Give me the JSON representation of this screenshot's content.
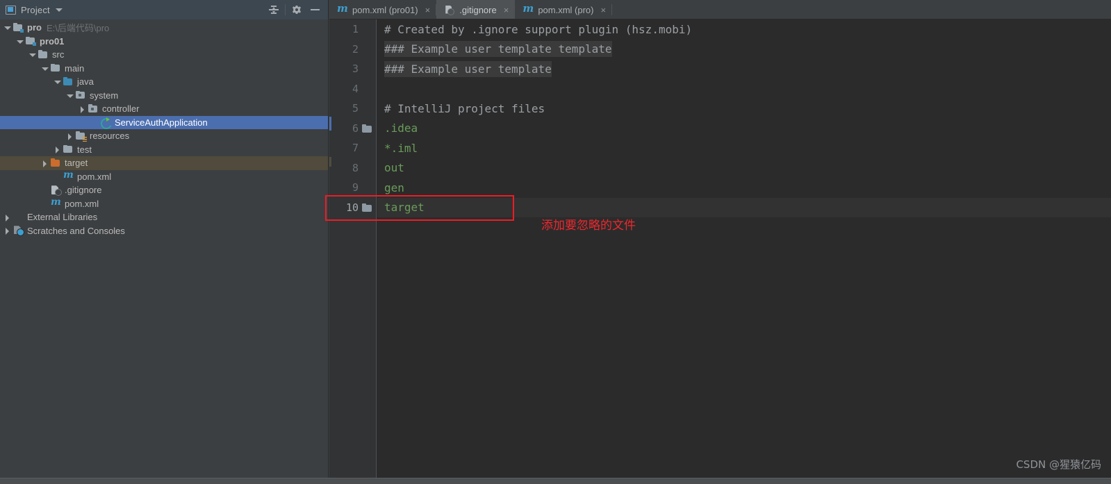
{
  "panel": {
    "title": "Project",
    "icons": {
      "panel_icon": "project-window-icon",
      "dropdown": "chevron-down-icon",
      "collapse_all": "collapse-all-icon",
      "settings": "gear-icon",
      "hide": "minimize-icon"
    }
  },
  "tree": {
    "items": [
      {
        "label": "pro",
        "path": "E:\\后端代码\\pro",
        "indent": 0,
        "arrow": "down",
        "icon": "module-folder-icon",
        "bold": true,
        "state": "normal"
      },
      {
        "label": "pro01",
        "path": "",
        "indent": 1,
        "arrow": "down",
        "icon": "module-folder-icon",
        "bold": true,
        "state": "normal"
      },
      {
        "label": "src",
        "path": "",
        "indent": 2,
        "arrow": "down",
        "icon": "folder-icon",
        "bold": false,
        "state": "normal"
      },
      {
        "label": "main",
        "path": "",
        "indent": 3,
        "arrow": "down",
        "icon": "folder-icon",
        "bold": false,
        "state": "normal"
      },
      {
        "label": "java",
        "path": "",
        "indent": 4,
        "arrow": "down",
        "icon": "source-folder-icon",
        "bold": false,
        "state": "normal"
      },
      {
        "label": "system",
        "path": "",
        "indent": 5,
        "arrow": "down",
        "icon": "package-icon",
        "bold": false,
        "state": "normal"
      },
      {
        "label": "controller",
        "path": "",
        "indent": 6,
        "arrow": "right",
        "icon": "package-icon",
        "bold": false,
        "state": "normal"
      },
      {
        "label": "ServiceAuthApplication",
        "path": "",
        "indent": 7,
        "arrow": "none",
        "icon": "spring-boot-class-icon",
        "bold": false,
        "state": "selected"
      },
      {
        "label": "resources",
        "path": "",
        "indent": 5,
        "arrow": "right",
        "icon": "resources-folder-icon",
        "bold": false,
        "state": "normal"
      },
      {
        "label": "test",
        "path": "",
        "indent": 4,
        "arrow": "right",
        "icon": "folder-icon",
        "bold": false,
        "state": "normal"
      },
      {
        "label": "target",
        "path": "",
        "indent": 3,
        "arrow": "right",
        "icon": "excluded-folder-icon",
        "bold": false,
        "state": "marked"
      },
      {
        "label": "pom.xml",
        "path": "",
        "indent": 4,
        "arrow": "none",
        "icon": "maven-file-icon",
        "bold": false,
        "state": "normal"
      },
      {
        "label": ".gitignore",
        "path": "",
        "indent": 3,
        "arrow": "none",
        "icon": "gitignore-file-icon",
        "bold": false,
        "state": "normal"
      },
      {
        "label": "pom.xml",
        "path": "",
        "indent": 3,
        "arrow": "none",
        "icon": "maven-file-icon",
        "bold": false,
        "state": "normal"
      },
      {
        "label": "External Libraries",
        "path": "",
        "indent": 0,
        "arrow": "right",
        "icon": "libraries-icon",
        "bold": false,
        "state": "normal"
      },
      {
        "label": "Scratches and Consoles",
        "path": "",
        "indent": 0,
        "arrow": "right",
        "icon": "scratches-icon",
        "bold": false,
        "state": "normal"
      }
    ]
  },
  "tabs": [
    {
      "label": "pom.xml (pro01)",
      "icon": "maven-file-icon",
      "active": false,
      "close": "×"
    },
    {
      "label": ".gitignore",
      "icon": "gitignore-file-icon",
      "active": true,
      "close": "×"
    },
    {
      "label": "pom.xml (pro)",
      "icon": "maven-file-icon",
      "active": false,
      "close": "×"
    }
  ],
  "editor": {
    "lines": [
      {
        "num": "1",
        "text": "# Created by .ignore support plugin (hsz.mobi)",
        "kind": "comment",
        "fold": false,
        "current": false,
        "dup": false
      },
      {
        "num": "2",
        "text": "### Example user template template",
        "kind": "comment",
        "fold": false,
        "current": false,
        "dup": true
      },
      {
        "num": "3",
        "text": "### Example user template",
        "kind": "comment",
        "fold": false,
        "current": false,
        "dup": true
      },
      {
        "num": "4",
        "text": "",
        "kind": "comment",
        "fold": false,
        "current": false,
        "dup": false
      },
      {
        "num": "5",
        "text": "# IntelliJ project files",
        "kind": "comment",
        "fold": false,
        "current": false,
        "dup": false
      },
      {
        "num": "6",
        "text": ".idea",
        "kind": "entry",
        "fold": true,
        "current": false,
        "dup": false
      },
      {
        "num": "7",
        "text": "*.iml",
        "kind": "entry",
        "fold": false,
        "current": false,
        "dup": false
      },
      {
        "num": "8",
        "text": "out",
        "kind": "entry",
        "fold": false,
        "current": false,
        "dup": false
      },
      {
        "num": "9",
        "text": "gen",
        "kind": "entry",
        "fold": false,
        "current": false,
        "dup": false
      },
      {
        "num": "10",
        "text": "target",
        "kind": "entry",
        "fold": true,
        "current": true,
        "dup": false
      }
    ]
  },
  "annotation": {
    "text": "添加要忽略的文件",
    "color": "#f0272e"
  },
  "watermark": {
    "text": "CSDN @猩猿亿码"
  },
  "colors": {
    "panel_bg": "#3c3f41",
    "editor_bg": "#2b2b2b",
    "gutter_bg": "#313335",
    "selection": "#4b6eaf",
    "marked_row": "#504b3c",
    "entry_green": "#6a9c5a",
    "comment_gray": "#9ba0a4",
    "accent_blue": "#3d9fd0",
    "annotation_red": "#ee1c25"
  }
}
